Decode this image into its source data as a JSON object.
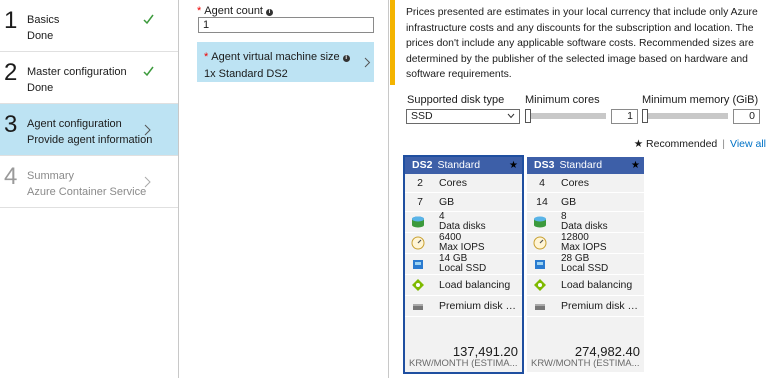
{
  "steps": [
    {
      "number": "1",
      "title": "Basics",
      "subtitle": "Done",
      "state": "done"
    },
    {
      "number": "2",
      "title": "Master configuration",
      "subtitle": "Done",
      "state": "done"
    },
    {
      "number": "3",
      "title": "Agent configuration",
      "subtitle": "Provide agent information",
      "state": "active"
    },
    {
      "number": "4",
      "title": "Summary",
      "subtitle": "Azure Container Service",
      "state": "disabled"
    }
  ],
  "agent": {
    "count_label": "Agent count",
    "count_value": "1",
    "vm_size_label": "Agent virtual machine size",
    "vm_size_value": "1x Standard DS2"
  },
  "notice": "Prices presented are estimates in your local currency that include only Azure infrastructure costs and any discounts for the subscription and location. The prices don't include any applicable software costs. Recommended sizes are determined by the publisher of the selected image based on hardware and software requirements.",
  "filters": {
    "disk_type_label": "Supported disk type",
    "disk_type_value": "SSD",
    "min_cores_label": "Minimum cores",
    "min_cores_value": "1",
    "min_memory_label": "Minimum memory (GiB)",
    "min_memory_value": "0"
  },
  "recommended_label": "★ Recommended",
  "separator": "|",
  "view_all_label": "View all",
  "cards": [
    {
      "code": "DS2",
      "tier": "Standard",
      "star": "★",
      "cores": "2",
      "cores_unit": "Cores",
      "gb": "7",
      "gb_unit": "GB",
      "data_disks": "4",
      "data_disks_label": "Data disks",
      "iops": "6400",
      "iops_label": "Max IOPS",
      "ssd": "14 GB",
      "ssd_label": "Local SSD",
      "load_balancing": "Load balancing",
      "premium_disk": "Premium disk su...",
      "price": "137,491.20",
      "price_unit": "KRW/MONTH (ESTIMA...",
      "selected": true
    },
    {
      "code": "DS3",
      "tier": "Standard",
      "star": "★",
      "cores": "4",
      "cores_unit": "Cores",
      "gb": "14",
      "gb_unit": "GB",
      "data_disks": "8",
      "data_disks_label": "Data disks",
      "iops": "12800",
      "iops_label": "Max IOPS",
      "ssd": "28 GB",
      "ssd_label": "Local SSD",
      "load_balancing": "Load balancing",
      "premium_disk": "Premium disk su...",
      "price": "274,982.40",
      "price_unit": "KRW/MONTH (ESTIMA...",
      "selected": false
    }
  ],
  "colors": {
    "active_step_bg": "#bde3f3",
    "card_header": "#3d5fa8",
    "selected_outline": "#1f4fa0",
    "check_green": "#3c9a3c",
    "notice_accent": "#f4b400",
    "link": "#0072c6"
  },
  "icons": {
    "done": "check-icon",
    "nav": "chevron-right-icon",
    "disks": "data-disks-icon",
    "iops": "iops-gauge-icon",
    "ssd": "local-ssd-icon",
    "lb": "load-balancing-icon",
    "premium": "premium-disk-icon"
  }
}
